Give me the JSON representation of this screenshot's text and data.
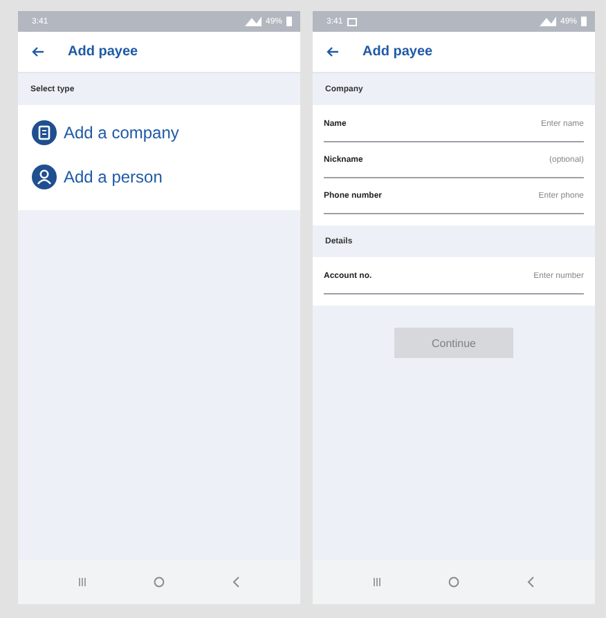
{
  "type_screen": {
    "status_bar": {
      "time": "3:41",
      "battery": "49%"
    },
    "header": {
      "title": "Add payee"
    },
    "section": "Select type",
    "options": [
      {
        "label": "Add a company",
        "kind": "company"
      },
      {
        "label": "Add a person",
        "kind": "person"
      }
    ]
  },
  "form_screen": {
    "status_bar": {
      "time": "3:41",
      "battery": "49%"
    },
    "header": {
      "title": "Add payee"
    },
    "sections": [
      {
        "title": "Company",
        "fields": [
          {
            "label": "Name",
            "placeholder": "Enter name"
          },
          {
            "label": "Nickname",
            "placeholder": "(optional)"
          },
          {
            "label": "Phone number",
            "placeholder": "Enter phone"
          }
        ]
      },
      {
        "title": "Details",
        "fields": [
          {
            "label": "Account no.",
            "placeholder": "Enter number"
          }
        ]
      }
    ],
    "button": {
      "label": "Continue",
      "disabled": true
    }
  }
}
